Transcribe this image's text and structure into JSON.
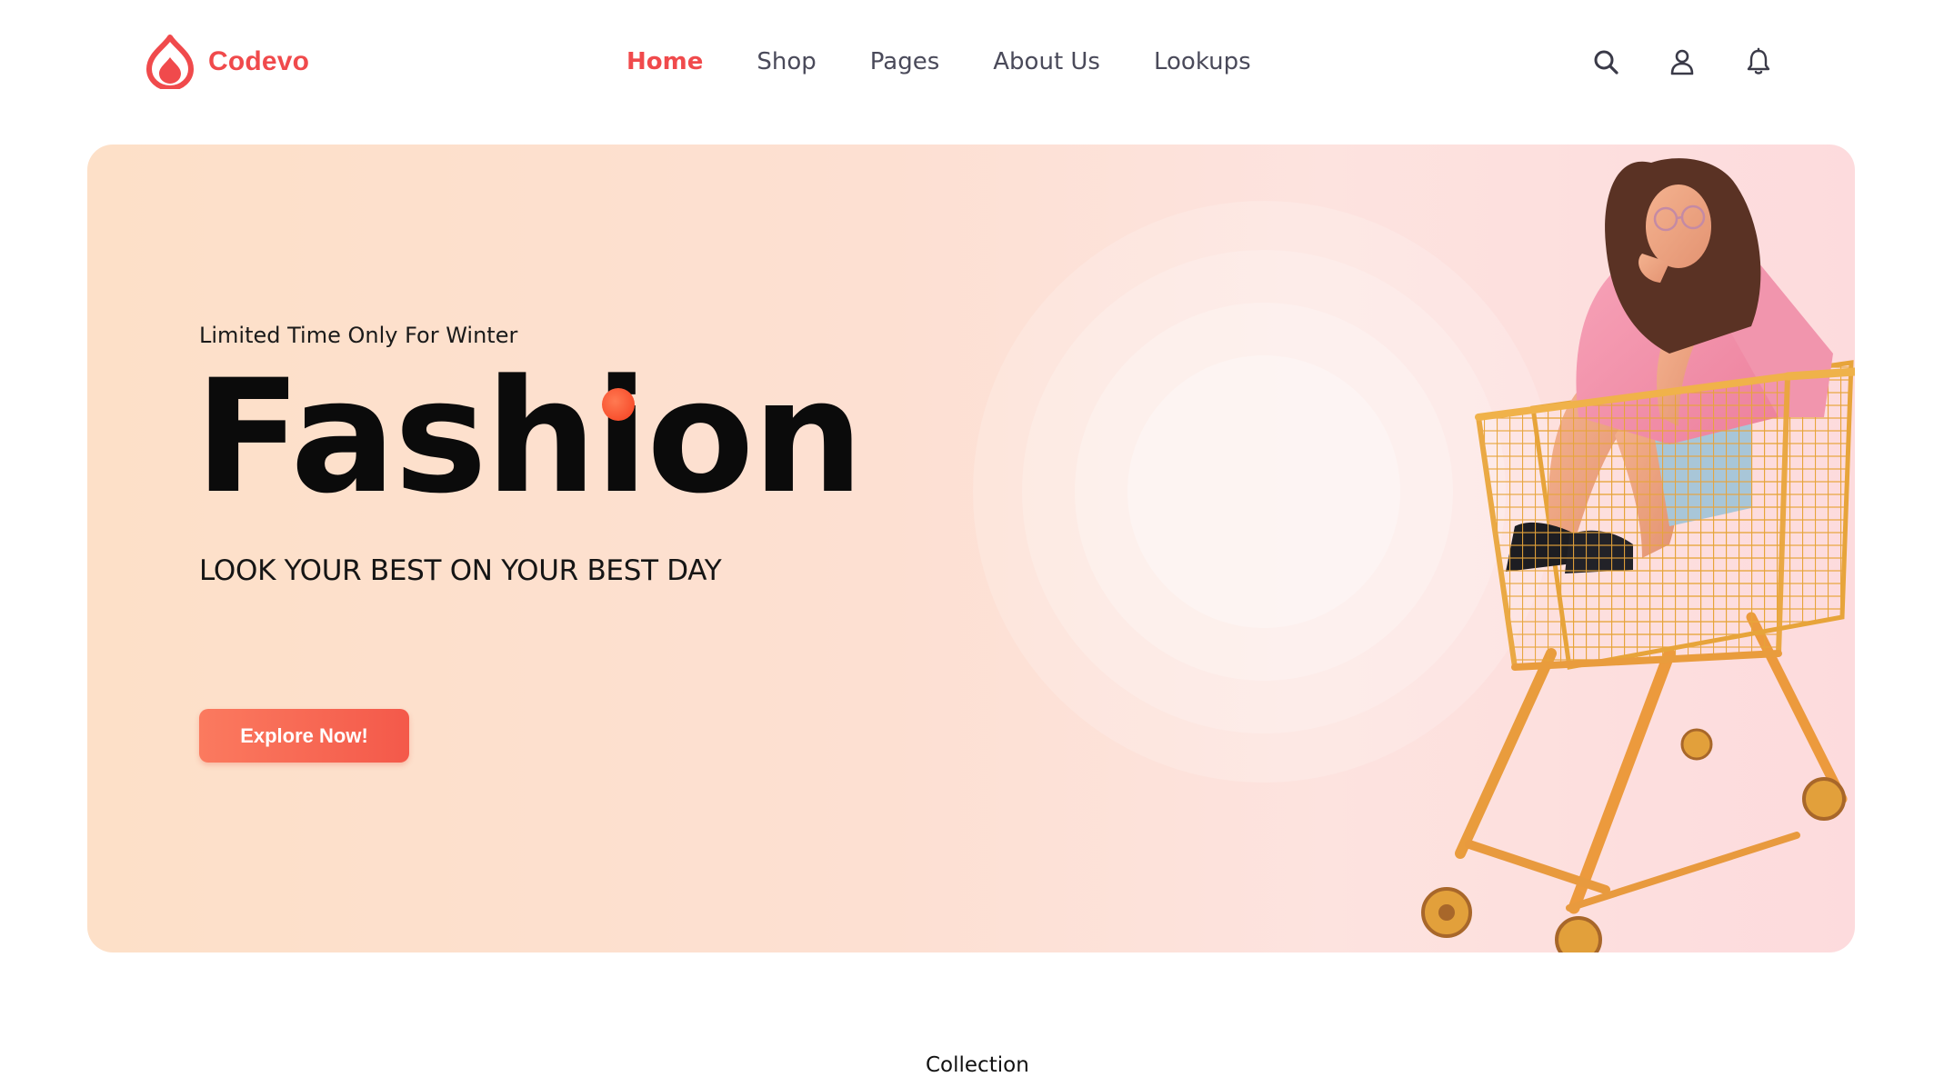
{
  "brand": {
    "name": "Codevo",
    "logo_icon": "flame-drop-icon",
    "color": "#f04a4c"
  },
  "nav": {
    "items": [
      {
        "label": "Home",
        "active": true
      },
      {
        "label": "Shop",
        "active": false
      },
      {
        "label": "Pages",
        "active": false
      },
      {
        "label": "About Us",
        "active": false
      },
      {
        "label": "Lookups",
        "active": false
      }
    ],
    "active_color": "#f04a4c",
    "default_color": "#4a4a5a"
  },
  "header_actions": [
    {
      "icon": "search-icon"
    },
    {
      "icon": "user-icon"
    },
    {
      "icon": "bell-icon"
    }
  ],
  "hero": {
    "kicker": "Limited Time Only For Winter",
    "title": "Fashion",
    "subtitle": "LOOK YOUR BEST ON YOUR BEST DAY",
    "cta_label": "Explore Now!",
    "accent_color": "#f4594a",
    "image": "woman-in-shopping-cart-image"
  },
  "section": {
    "label": "Collection"
  }
}
